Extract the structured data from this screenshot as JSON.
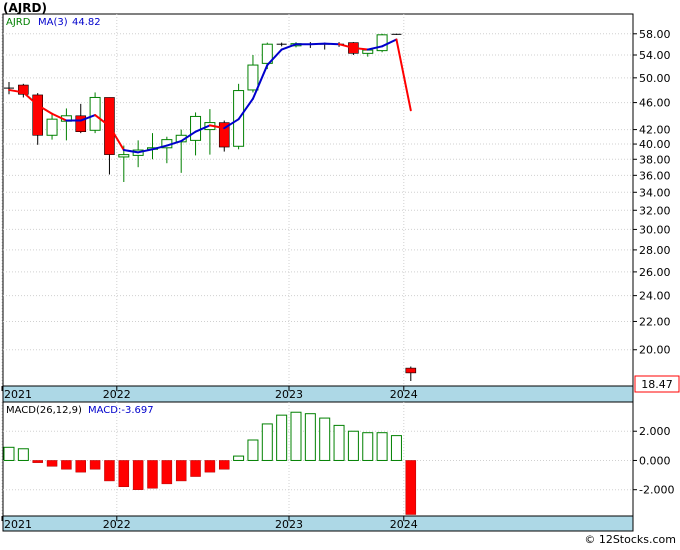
{
  "title": "(AJRD)",
  "footer": "© 12Stocks.com",
  "colors": {
    "up": "#008000",
    "down": "#ff0000",
    "ma_blue": "#0000cc",
    "ma_red": "#ff0000",
    "axis_band": "#add8e6",
    "grid": "#d0d0d0",
    "frame": "#000000",
    "last_price_border": "#ff0000"
  },
  "chart_data": [
    {
      "type": "candlestick",
      "scale": "log",
      "legend": {
        "ticker": "AJRD",
        "ma_label": "MA(3)",
        "ma_value": "44.82"
      },
      "ylim": [
        17.7,
        62.0
      ],
      "yticks": [
        20,
        22,
        24,
        26,
        28,
        30,
        32,
        34,
        36,
        38,
        40,
        42,
        46,
        50,
        54,
        58
      ],
      "ytick_labels": [
        "20.00",
        "22.00",
        "24.00",
        "26.00",
        "28.00",
        "30.00",
        "32.00",
        "34.00",
        "36.00",
        "38.00",
        "40.00",
        "42.00",
        "46.00",
        "50.00",
        "54.00",
        "58.00"
      ],
      "last_price": "18.47",
      "last_price_value": 18.47,
      "x_year_labels": [
        {
          "label": "2021",
          "index": 0
        },
        {
          "label": "2022",
          "index": 8
        },
        {
          "label": "2023",
          "index": 20
        },
        {
          "label": "2024",
          "index": 28
        }
      ],
      "candles": [
        {
          "i": 0,
          "o": 48.3,
          "h": 49.3,
          "l": 47.3,
          "c": 48.3,
          "dir": "flat"
        },
        {
          "i": 1,
          "o": 48.8,
          "h": 49.0,
          "l": 46.8,
          "c": 47.3,
          "dir": "down"
        },
        {
          "i": 2,
          "o": 47.2,
          "h": 47.5,
          "l": 39.9,
          "c": 41.2,
          "dir": "down"
        },
        {
          "i": 3,
          "o": 41.2,
          "h": 44.2,
          "l": 40.6,
          "c": 43.5,
          "dir": "up"
        },
        {
          "i": 4,
          "o": 43.2,
          "h": 45.1,
          "l": 40.5,
          "c": 44.0,
          "dir": "up"
        },
        {
          "i": 5,
          "o": 44.0,
          "h": 45.8,
          "l": 41.5,
          "c": 41.7,
          "dir": "down"
        },
        {
          "i": 6,
          "o": 41.9,
          "h": 47.6,
          "l": 41.5,
          "c": 46.8,
          "dir": "up"
        },
        {
          "i": 7,
          "o": 46.8,
          "h": 46.8,
          "l": 36.1,
          "c": 38.6,
          "dir": "down"
        },
        {
          "i": 8,
          "o": 38.3,
          "h": 39.8,
          "l": 35.2,
          "c": 38.6,
          "dir": "up"
        },
        {
          "i": 9,
          "o": 38.5,
          "h": 40.5,
          "l": 37.0,
          "c": 39.2,
          "dir": "up"
        },
        {
          "i": 10,
          "o": 39.3,
          "h": 41.5,
          "l": 38.0,
          "c": 39.5,
          "dir": "up"
        },
        {
          "i": 11,
          "o": 39.5,
          "h": 41.0,
          "l": 37.5,
          "c": 40.6,
          "dir": "up"
        },
        {
          "i": 12,
          "o": 40.3,
          "h": 42.0,
          "l": 36.3,
          "c": 41.2,
          "dir": "up"
        },
        {
          "i": 13,
          "o": 40.5,
          "h": 44.5,
          "l": 38.5,
          "c": 43.9,
          "dir": "up"
        },
        {
          "i": 14,
          "o": 42.0,
          "h": 45.0,
          "l": 38.6,
          "c": 43.0,
          "dir": "up"
        },
        {
          "i": 15,
          "o": 43.0,
          "h": 43.3,
          "l": 39.0,
          "c": 39.6,
          "dir": "down"
        },
        {
          "i": 16,
          "o": 39.7,
          "h": 49.0,
          "l": 39.3,
          "c": 47.9,
          "dir": "up"
        },
        {
          "i": 17,
          "o": 48.0,
          "h": 54.0,
          "l": 47.6,
          "c": 52.2,
          "dir": "up"
        },
        {
          "i": 18,
          "o": 52.5,
          "h": 56.3,
          "l": 51.5,
          "c": 56.0,
          "dir": "up"
        },
        {
          "i": 19,
          "o": 56.0,
          "h": 56.3,
          "l": 55.6,
          "c": 56.0,
          "dir": "flat"
        },
        {
          "i": 20,
          "o": 55.7,
          "h": 56.4,
          "l": 55.4,
          "c": 56.1,
          "dir": "up"
        },
        {
          "i": 21,
          "o": 55.9,
          "h": 56.4,
          "l": 55.3,
          "c": 56.0,
          "dir": "flat"
        },
        {
          "i": 22,
          "o": 55.8,
          "h": 56.3,
          "l": 55.0,
          "c": 56.0,
          "dir": "flat"
        },
        {
          "i": 23,
          "o": 56.0,
          "h": 56.4,
          "l": 55.5,
          "c": 56.0,
          "dir": "flat"
        },
        {
          "i": 24,
          "o": 56.3,
          "h": 56.4,
          "l": 54.0,
          "c": 54.3,
          "dir": "down"
        },
        {
          "i": 25,
          "o": 54.3,
          "h": 55.0,
          "l": 53.7,
          "c": 54.9,
          "dir": "up"
        },
        {
          "i": 26,
          "o": 54.8,
          "h": 58.0,
          "l": 54.5,
          "c": 57.8,
          "dir": "up"
        },
        {
          "i": 27,
          "o": 57.9,
          "h": 58.0,
          "l": 57.8,
          "c": 57.9,
          "dir": "flat"
        },
        {
          "i": 28,
          "o": 18.8,
          "h": 18.9,
          "l": 18.0,
          "c": 18.5,
          "dir": "down"
        }
      ],
      "ma_series": [
        {
          "i": 0,
          "v": 48.0,
          "trend": "down"
        },
        {
          "i": 1,
          "v": 47.6,
          "trend": "down"
        },
        {
          "i": 2,
          "v": 45.6,
          "trend": "down"
        },
        {
          "i": 3,
          "v": 44.3,
          "trend": "down"
        },
        {
          "i": 4,
          "v": 43.3,
          "trend": "down"
        },
        {
          "i": 5,
          "v": 43.3,
          "trend": "up"
        },
        {
          "i": 6,
          "v": 44.1,
          "trend": "up"
        },
        {
          "i": 7,
          "v": 42.5,
          "trend": "down"
        },
        {
          "i": 8,
          "v": 39.2,
          "trend": "down"
        },
        {
          "i": 9,
          "v": 38.9,
          "trend": "up"
        },
        {
          "i": 10,
          "v": 39.3,
          "trend": "up"
        },
        {
          "i": 11,
          "v": 39.8,
          "trend": "up"
        },
        {
          "i": 12,
          "v": 40.4,
          "trend": "up"
        },
        {
          "i": 13,
          "v": 41.7,
          "trend": "up"
        },
        {
          "i": 14,
          "v": 42.6,
          "trend": "up"
        },
        {
          "i": 15,
          "v": 42.2,
          "trend": "down"
        },
        {
          "i": 16,
          "v": 43.5,
          "trend": "up"
        },
        {
          "i": 17,
          "v": 46.6,
          "trend": "up"
        },
        {
          "i": 18,
          "v": 52.2,
          "trend": "up"
        },
        {
          "i": 19,
          "v": 55.0,
          "trend": "up"
        },
        {
          "i": 20,
          "v": 56.0,
          "trend": "up"
        },
        {
          "i": 21,
          "v": 56.0,
          "trend": "up"
        },
        {
          "i": 22,
          "v": 56.1,
          "trend": "up"
        },
        {
          "i": 23,
          "v": 56.0,
          "trend": "up"
        },
        {
          "i": 24,
          "v": 55.3,
          "trend": "down"
        },
        {
          "i": 25,
          "v": 55.0,
          "trend": "down"
        },
        {
          "i": 26,
          "v": 55.6,
          "trend": "up"
        },
        {
          "i": 27,
          "v": 56.9,
          "trend": "up"
        },
        {
          "i": 28,
          "v": 44.82,
          "trend": "down"
        }
      ]
    },
    {
      "type": "bar",
      "legend": {
        "label": "MACD(26,12,9)",
        "value_label": "MACD:-3.697"
      },
      "ylim": [
        -3.8,
        4.0
      ],
      "yticks": [
        2.0,
        0.0,
        -2.0
      ],
      "ytick_labels": [
        "2.000",
        "0.000",
        "-2.000"
      ],
      "x_year_labels": [
        {
          "label": "2021",
          "index": 0
        },
        {
          "label": "2022",
          "index": 8
        },
        {
          "label": "2023",
          "index": 20
        },
        {
          "label": "2024",
          "index": 28
        }
      ],
      "values": [
        0.9,
        0.8,
        -0.15,
        -0.4,
        -0.6,
        -0.8,
        -0.6,
        -1.4,
        -1.8,
        -2.0,
        -1.9,
        -1.6,
        -1.4,
        -1.1,
        -0.8,
        -0.6,
        0.3,
        1.4,
        2.5,
        3.1,
        3.3,
        3.2,
        2.9,
        2.4,
        2.0,
        1.9,
        1.9,
        1.7,
        -3.697
      ]
    }
  ]
}
